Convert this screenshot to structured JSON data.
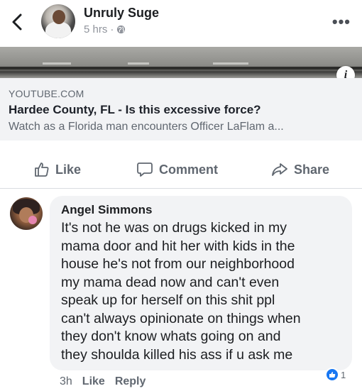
{
  "post": {
    "author": "Unruly Suge",
    "time": "5 hrs",
    "separator": "·",
    "more_label": "•••",
    "privacy_icon": "globe-icon"
  },
  "link_preview": {
    "info_label": "i",
    "domain": "YOUTUBE.COM",
    "title": "Hardee County, FL - Is this excessive force?",
    "description": "Watch as a Florida man encounters Officer LaFlam a..."
  },
  "actions": {
    "like": "Like",
    "comment": "Comment",
    "share": "Share"
  },
  "comment": {
    "author": "Angel Simmons",
    "lines": [
      "It's not he was on drugs kicked in my",
      "mama door and hit her with kids in the",
      "house he's not from our neighborhood",
      "my mama dead now and can't even",
      "speak up for herself on this shit ppl",
      "can't always opinionate on things when",
      "they don't know whats going on and",
      "they shoulda killed his ass if u ask me"
    ],
    "time": "3h",
    "like": "Like",
    "reply": "Reply",
    "reaction_count": "1"
  },
  "colors": {
    "accent": "#1877f2",
    "muted": "#606770",
    "bubble": "#f2f3f5"
  }
}
